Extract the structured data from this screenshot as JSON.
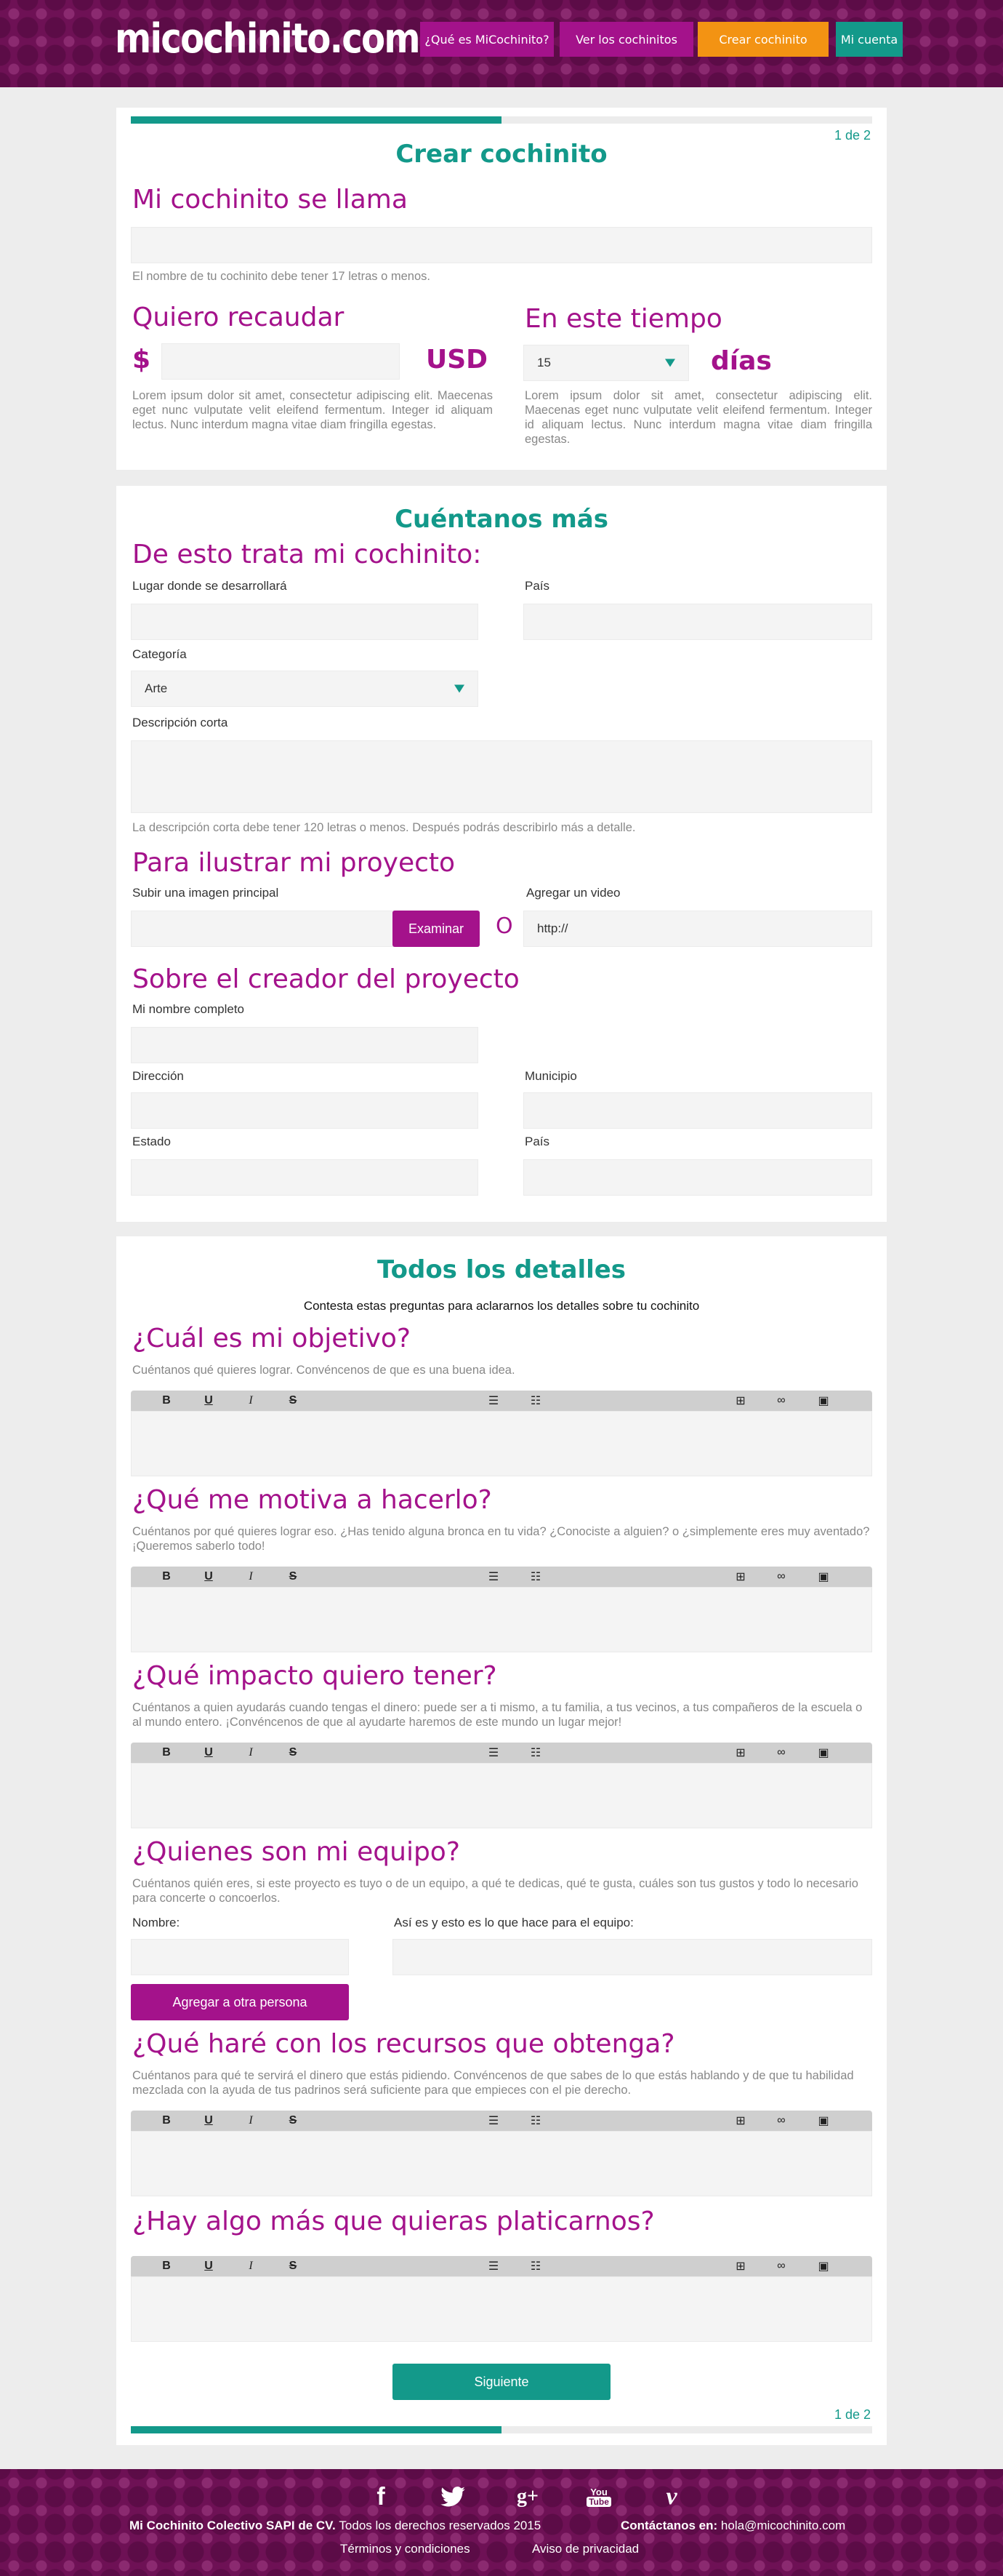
{
  "header": {
    "logo": "micochinito.com",
    "nav": [
      "¿Qué es MiCochinito?",
      "Ver los cochinitos",
      "Crear cochinito",
      "Mi cuenta"
    ],
    "colors": {
      "nav1": "#a4128b",
      "nav2": "#a4128b",
      "nav3": "#f39313",
      "nav4": "#13998a"
    }
  },
  "progress": {
    "label": "1 de 2",
    "value": 0.5
  },
  "step1": {
    "title": "Crear cochinito",
    "name_heading": "Mi cochinito se llama",
    "name_help": "El nombre de tu cochinito debe tener 17 letras o menos.",
    "amount_heading": "Quiero recaudar",
    "currency_symbol": "$",
    "currency": "USD",
    "time_heading": "En este tiempo",
    "days_value": "15",
    "days_unit": "días",
    "lorem": "Lorem ipsum dolor sit amet, consectetur adipiscing elit. Maecenas eget nunc vulputate velit eleifend fermentum. Integer id aliquam lectus. Nunc interdum magna vitae diam fringilla egestas."
  },
  "step2": {
    "title": "Cuéntanos más",
    "about_heading": "De esto trata mi cochinito:",
    "place_label": "Lugar donde se desarrollará",
    "country_label": "País",
    "category_label": "Categoría",
    "category_value": "Arte",
    "desc_label": "Descripción corta",
    "desc_help": "La descripción corta debe tener 120 letras o menos. Después podrás describirlo más a detalle.",
    "illustrate_heading": "Para ilustrar mi proyecto",
    "image_label": "Subir una imagen principal",
    "browse": "Examinar",
    "or": "O",
    "video_label": "Agregar un video",
    "video_value": "http://",
    "creator_heading": "Sobre el creador del proyecto",
    "fullname_label": "Mi nombre completo",
    "address_label": "Dirección",
    "municipality_label": "Municipio",
    "state_label": "Estado",
    "country2_label": "País"
  },
  "step3": {
    "title": "Todos los detalles",
    "intro": "Contesta estas preguntas para aclararnos los detalles sobre tu cochinito",
    "q1": "¿Cuál es mi objetivo?",
    "q1_help": "Cuéntanos qué quieres lograr. Convéncenos de que es una buena idea.",
    "q2": "¿Qué me motiva a hacerlo?",
    "q2_help": "Cuéntanos por qué quieres lograr eso. ¿Has tenido alguna bronca en tu vida? ¿Conociste a alguien? o ¿simplemente eres muy aventado? ¡Queremos saberlo todo!",
    "q3": "¿Qué impacto quiero tener?",
    "q3_help": "Cuéntanos a quien ayudarás cuando tengas el dinero: puede ser a ti mismo, a tu familia, a tus vecinos, a tus compañeros de la escuela o al mundo entero. ¡Convéncenos de que al ayudarte haremos de este mundo un lugar mejor!",
    "q4": "¿Quienes son mi equipo?",
    "q4_help": "Cuéntanos quién eres, si este proyecto es tuyo o de un equipo, a qué te dedicas, qué te gusta, cuáles son tus gustos y todo lo necesario para concerte o concoerlos.",
    "team_name_label": "Nombre:",
    "team_role_label": "Así es y esto es lo que hace para el equipo:",
    "add_person": "Agregar a otra persona",
    "q5": "¿Qué haré con los recursos que obtenga?",
    "q5_help": "Cuéntanos para qué te servirá el dinero que estás pidiendo. Convéncenos de que sabes de lo que estás hablando y de que tu habilidad mezclada con la ayuda de tus padrinos será suficiente para que empieces con el pie derecho.",
    "q6": "¿Hay algo más que quieras platicarnos?",
    "next": "Siguiente"
  },
  "toolbar": {
    "bold": "B",
    "underline": "U",
    "italic": "I",
    "strike": "S",
    "icons": [
      "bullet-list-icon",
      "numbered-list-icon",
      "table-icon",
      "link-icon",
      "image-icon"
    ]
  },
  "footer": {
    "social": [
      "facebook-icon",
      "twitter-icon",
      "google-plus-icon",
      "youtube-icon",
      "vimeo-icon"
    ],
    "company": "Mi Cochinito Colectivo SAPI de CV.",
    "rights": "Todos los derechos reservados 2015",
    "contact_label": "Contáctanos en:",
    "email": "hola@micochinito.com",
    "terms": "Términos y condiciones",
    "privacy": "Aviso de privacidad"
  }
}
